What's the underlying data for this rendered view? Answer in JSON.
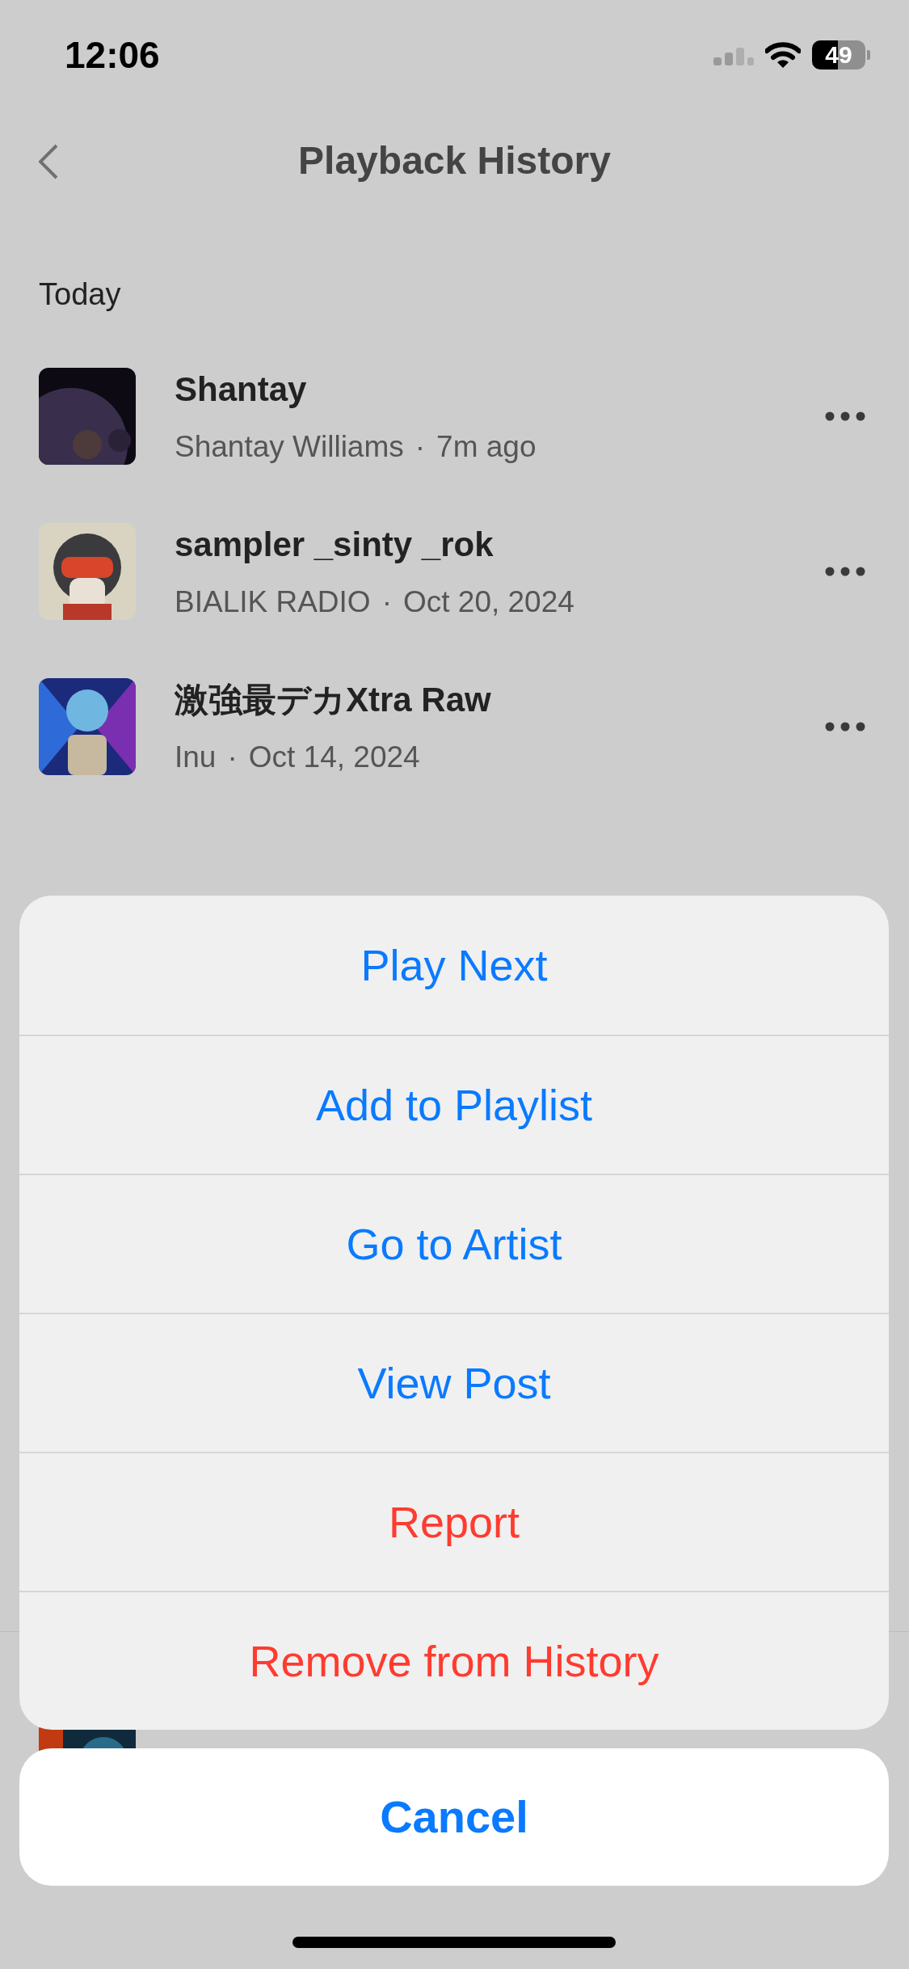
{
  "status_bar": {
    "time": "12:06",
    "battery": "49"
  },
  "nav": {
    "title": "Playback History"
  },
  "section": "Today",
  "separator": "·",
  "tracks": [
    {
      "title": "Shantay",
      "artist": "Shantay Williams",
      "when": "7m ago"
    },
    {
      "title": "sampler _sinty _rok",
      "artist": "BIALIK RADIO",
      "when": "Oct 20, 2024"
    },
    {
      "title": "激強最デカXtra Raw",
      "artist": "Inu",
      "when": "Oct 14, 2024"
    }
  ],
  "action_sheet": {
    "actions": [
      {
        "label": "Play Next",
        "kind": "default"
      },
      {
        "label": "Add to Playlist",
        "kind": "default"
      },
      {
        "label": "Go to Artist",
        "kind": "default"
      },
      {
        "label": "View Post",
        "kind": "default"
      },
      {
        "label": "Report",
        "kind": "destructive"
      },
      {
        "label": "Remove from History",
        "kind": "destructive"
      }
    ],
    "cancel": "Cancel"
  }
}
